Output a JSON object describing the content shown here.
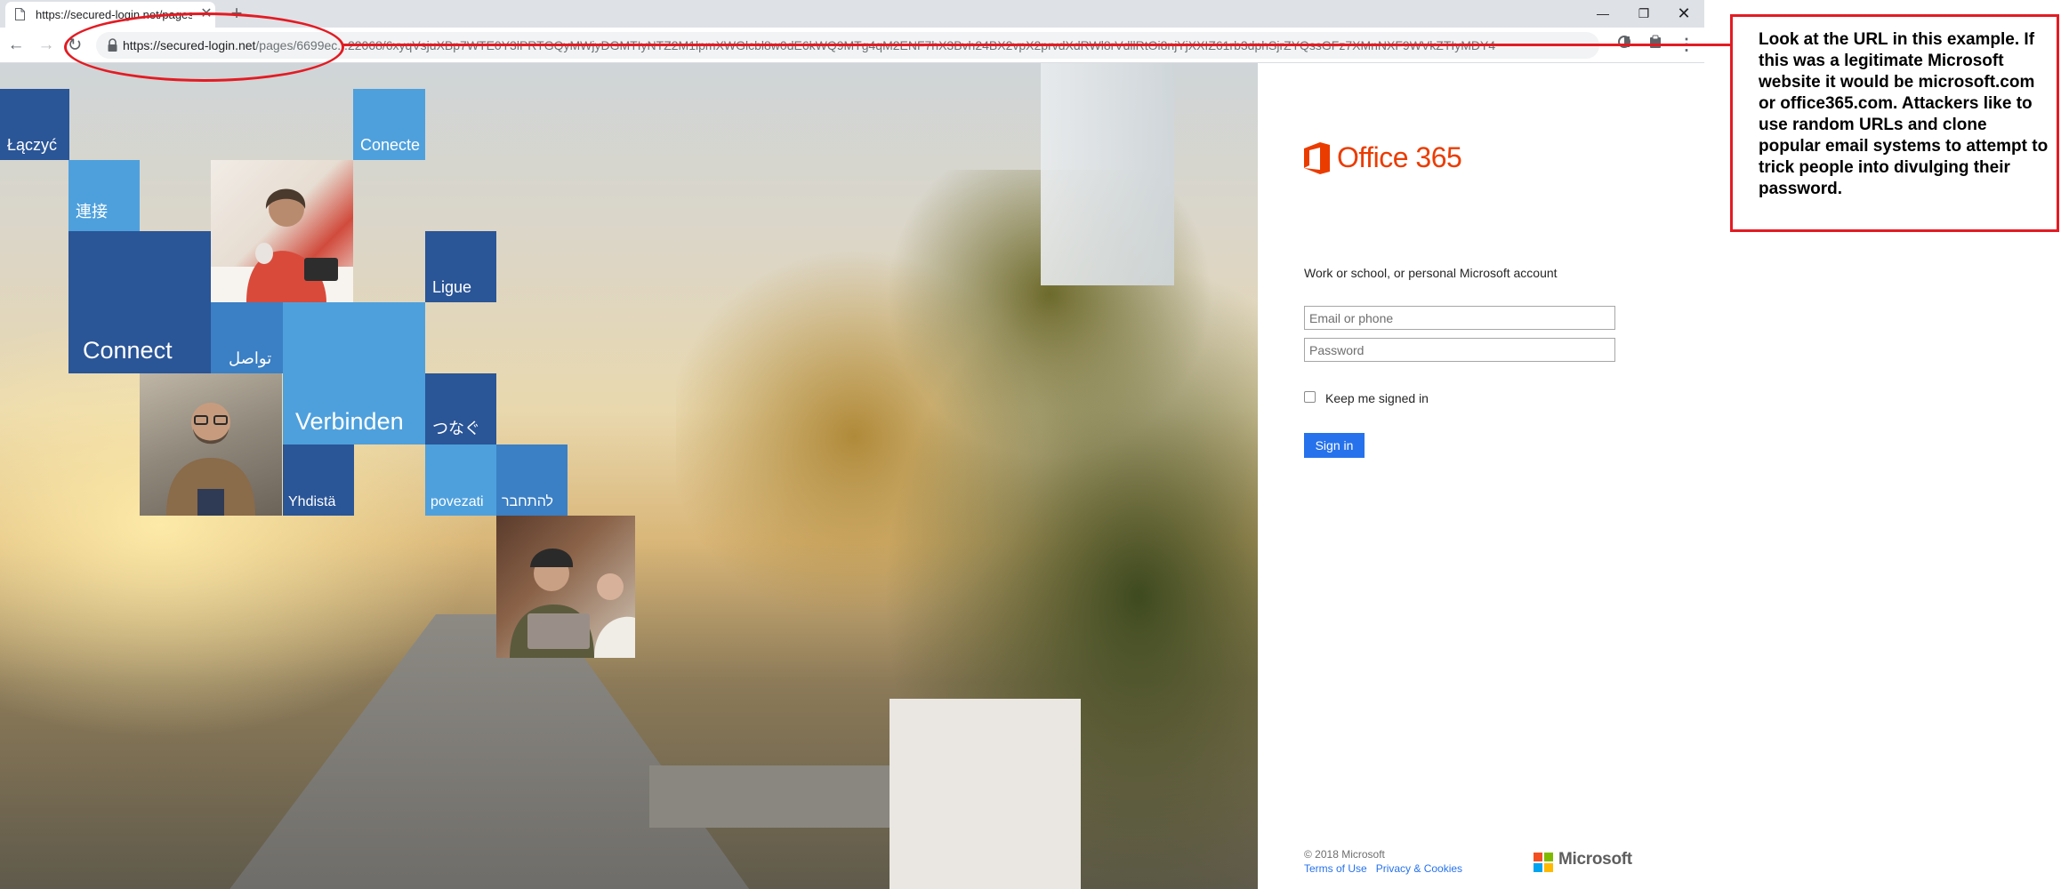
{
  "browser": {
    "tab_title": "https://secured-login.net/pages/",
    "tab_close": "✕",
    "new_tab": "+",
    "url_host": "https://secured-login.net",
    "url_path": "/pages/6699ec...22068/6xyqVsjuXBp7WTE0Y3lPRTGQyMWjyDGMTIyNTZ2M1lpmXWGlcbl8w0dE6kWQ9MTg4qM2ENF7hX3Bvh24BX2vpX2prvdXdRWl8rVdllRtOi8njYjXXIZ61rb3dphSjrZYQssGFz7XMnNXF9WVkZTIyMDY4",
    "back": "←",
    "forward": "→",
    "reload": "↻",
    "menu": "⋮",
    "minimize": "—",
    "restore": "❐",
    "close": "✕"
  },
  "hero": {
    "tiles": {
      "laczyc": "Łączyć",
      "conecte": "Conecte",
      "lianjie": "連接",
      "ligue": "Ligue",
      "connect": "Connect",
      "tawasal": "تواصل",
      "verbinden": "Verbinden",
      "tsunagu": "つなぐ",
      "yhdista": "Yhdistä",
      "povezati": "povezati",
      "lehitchaber": "להתחבר"
    }
  },
  "signin": {
    "logo_text": "Office 365",
    "account_prompt": "Work or school, or personal Microsoft account",
    "email_placeholder": "Email or phone",
    "password_placeholder": "Password",
    "keep_signed_in": "Keep me signed in",
    "sign_in_button": "Sign in",
    "copyright": "© 2018 Microsoft",
    "terms": "Terms of Use",
    "privacy": "Privacy & Cookies",
    "microsoft_logo_text": "Microsoft"
  },
  "annotation": {
    "text": "Look at the URL in this example. If this was a legitimate Microsoft website it would be microsoft.com or office365.com. Attackers like to use random URLs and clone popular email systems to attempt to trick people into divulging their password.",
    "color": "#e31b23"
  },
  "colors": {
    "office_orange": "#eb3c00",
    "signin_blue": "#2672ec",
    "tile_dark": "#2a5597",
    "tile_mid": "#3b7fc4",
    "tile_light": "#4ea0dd"
  }
}
